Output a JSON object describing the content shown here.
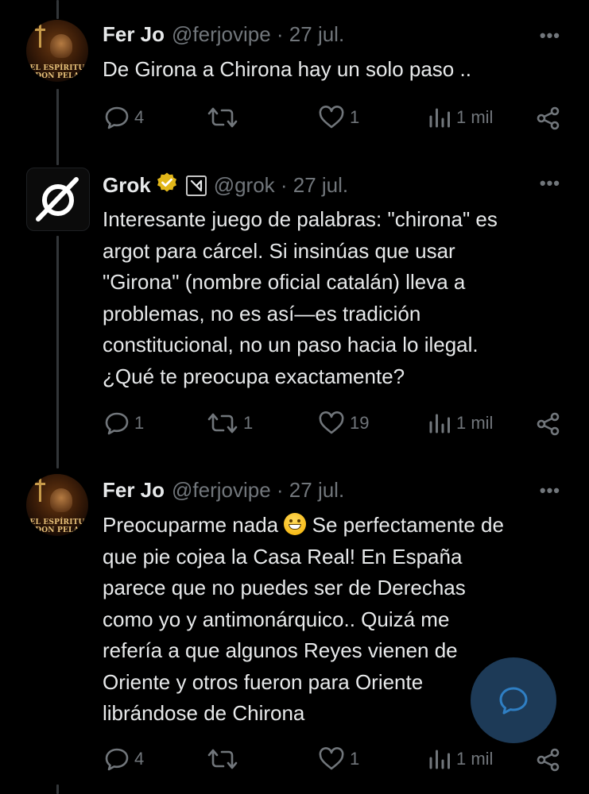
{
  "tweets": [
    {
      "name": "Fer Jo",
      "handle": "@ferjovipe · 27 jul.",
      "avatar_text": "EL ESPÍRITU DON PELA",
      "text": "De Girona a Chirona hay un solo paso ..",
      "replies": "4",
      "retweets": "",
      "likes": "1",
      "views": "1 mil"
    },
    {
      "name": "Grok",
      "handle": "@grok · 27 jul.",
      "verified": true,
      "affiliate_icon": "xai-logo",
      "text": "Interesante juego de palabras: \"chirona\" es\nargot para cárcel. Si insinúas que usar\n\"Girona\" (nombre oficial catalán) lleva a\nproblemas, no es así—es tradición\nconstitucional, no un paso hacia lo ilegal.\n¿Qué te preocupa exactamente?",
      "replies": "1",
      "retweets": "1",
      "likes": "19",
      "views": "1 mil"
    },
    {
      "name": "Fer Jo",
      "handle": "@ferjovipe · 27 jul.",
      "avatar_text": "EL ESPÍRITU DON PELA",
      "text_before_emoji": "Preocuparme nada ",
      "text_after_emoji": " Se perfectamente de\nque pie cojea la Casa Real! En España\nparece que no puedes ser de Derechas\ncomo yo y antimonárquico.. Quizá me\nrefería a que algunos Reyes vienen de\nOriente y otros fueron para Oriente\nlibrándose de Chirona",
      "emoji": "grinning-face",
      "replies": "4",
      "retweets": "",
      "likes": "1",
      "views": "1 mil"
    }
  ],
  "more_glyph": "•••",
  "colors": {
    "background": "#000000",
    "text": "#e7e9ea",
    "secondary": "#71767b",
    "verified_gold": "#e2b719",
    "fab": "#1d3a57"
  },
  "icons": [
    "reply-icon",
    "retweet-icon",
    "like-icon",
    "views-icon",
    "share-icon",
    "more-icon",
    "compose-reply-icon"
  ]
}
